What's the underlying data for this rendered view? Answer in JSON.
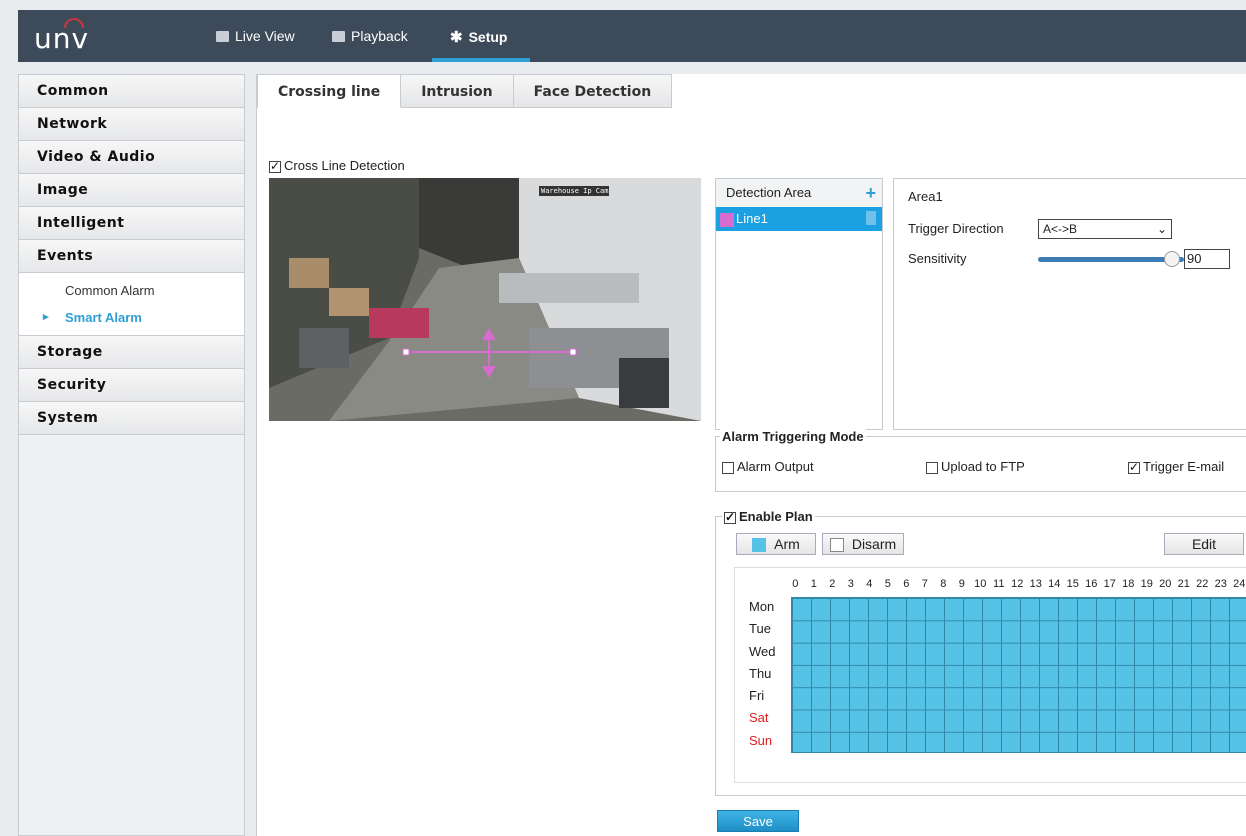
{
  "brand": {
    "logo": "unv"
  },
  "nav": {
    "live_view": "Live View",
    "playback": "Playback",
    "setup": "Setup"
  },
  "sidebar": {
    "items": [
      "Common",
      "Network",
      "Video & Audio",
      "Image",
      "Intelligent",
      "Events"
    ],
    "events_sub": [
      "Common Alarm",
      "Smart Alarm"
    ],
    "items_after": [
      "Storage",
      "Security",
      "System"
    ]
  },
  "tabs": [
    "Crossing line",
    "Intrusion",
    "Face Detection"
  ],
  "detection": {
    "checkbox_label": "Cross Line Detection",
    "enabled": true,
    "osd_text": "Warehouse Ip Cam"
  },
  "detection_area": {
    "header": "Detection Area",
    "add_icon": "plus-icon",
    "line_label": "Line1",
    "line_color": "#d66bd0"
  },
  "area": {
    "title": "Area1",
    "trigger_direction_label": "Trigger Direction",
    "trigger_direction_value": "A<->B",
    "sensitivity_label": "Sensitivity",
    "sensitivity_value": "90"
  },
  "alarm_mode": {
    "legend": "Alarm Triggering Mode",
    "alarm_output": "Alarm Output",
    "upload_ftp": "Upload to FTP",
    "trigger_email": "Trigger E-mail"
  },
  "plan": {
    "legend": "Enable Plan",
    "arm": "Arm",
    "disarm": "Disarm",
    "edit": "Edit",
    "arm_color": "#56c3e6",
    "hours": [
      "0",
      "1",
      "2",
      "3",
      "4",
      "5",
      "6",
      "7",
      "8",
      "9",
      "10",
      "11",
      "12",
      "13",
      "14",
      "15",
      "16",
      "17",
      "18",
      "19",
      "20",
      "21",
      "22",
      "23",
      "24"
    ],
    "days": [
      "Mon",
      "Tue",
      "Wed",
      "Thu",
      "Fri",
      "Sat",
      "Sun"
    ]
  },
  "save_label": "Save"
}
